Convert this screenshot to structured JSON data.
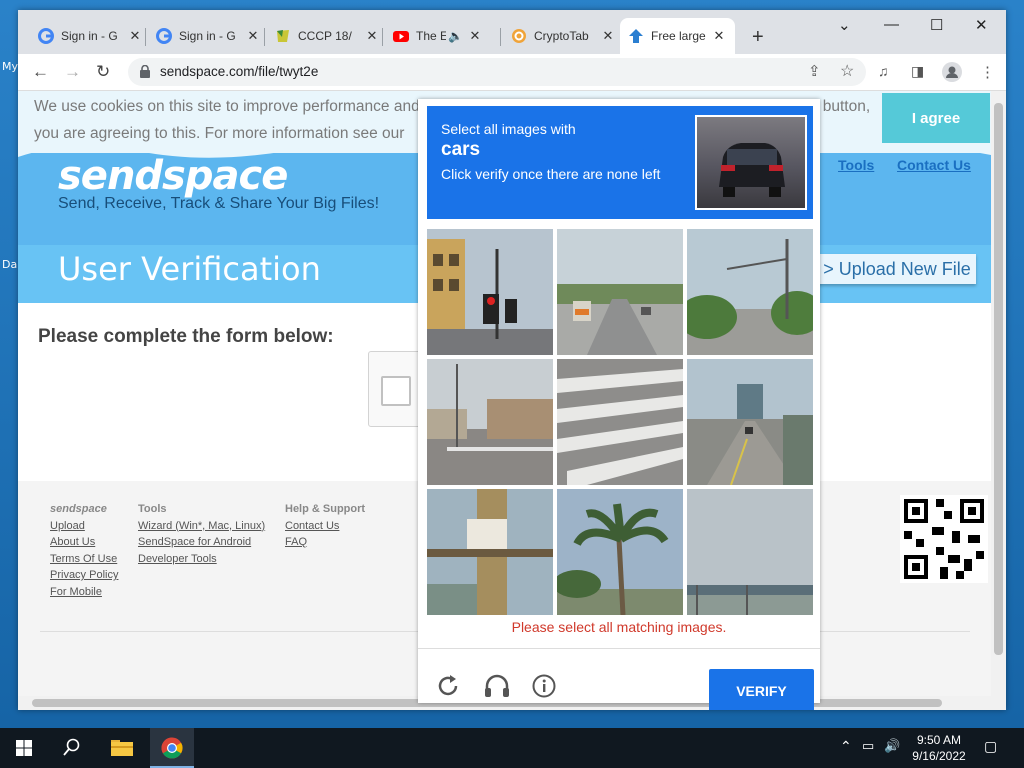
{
  "desktop": {
    "left_label_1": "My",
    "left_label_2": "Da"
  },
  "browser": {
    "tabs": [
      {
        "title": "Sign in - G",
        "active": false
      },
      {
        "title": "Sign in - G",
        "active": false
      },
      {
        "title": "CCCP 18/",
        "active": false
      },
      {
        "title": "The E",
        "active": false
      },
      {
        "title": "CryptoTab",
        "active": false
      },
      {
        "title": "Free large",
        "active": true
      }
    ],
    "url": "sendspace.com/file/twyt2e"
  },
  "page": {
    "cookie_text": "We use cookies on this site to improve performance and for analytics. By browsing this site, or clicking the 'I agree' button, you are agreeing to this. For more information see our",
    "agree_label": "I agree",
    "logo": "sendspace",
    "tagline": "Send, Receive, Track & Share Your Big Files!",
    "nav": {
      "tools": "Tools",
      "contact": "Contact Us"
    },
    "verification_title": "User Verification",
    "upload_label": "> Upload New File",
    "form_title": "Please complete the form below:"
  },
  "footer": {
    "col1": {
      "heading": "sendspace",
      "links": [
        "Upload",
        "About Us",
        "Terms Of Use",
        "Privacy Policy",
        "For Mobile"
      ]
    },
    "col2": {
      "heading": "Tools",
      "links": [
        "Wizard (Win*, Mac, Linux)",
        "SendSpace for Android",
        "Developer Tools"
      ]
    },
    "col3": {
      "heading": "Help & Support",
      "links": [
        "Contact Us",
        "FAQ"
      ]
    }
  },
  "captcha": {
    "line1": "Select all images with",
    "target": "cars",
    "line3": "Click verify once there are none left",
    "error": "Please select all matching images.",
    "verify_label": "VERIFY",
    "tiles": [
      "traffic-light-street",
      "truck-on-road",
      "road-trees-sky",
      "street-intersection",
      "crosswalk",
      "bridge-road",
      "pole-closeup",
      "palm-trees",
      "highway-overpass"
    ]
  },
  "taskbar": {
    "time": "9:50 AM",
    "date": "9/16/2022"
  }
}
